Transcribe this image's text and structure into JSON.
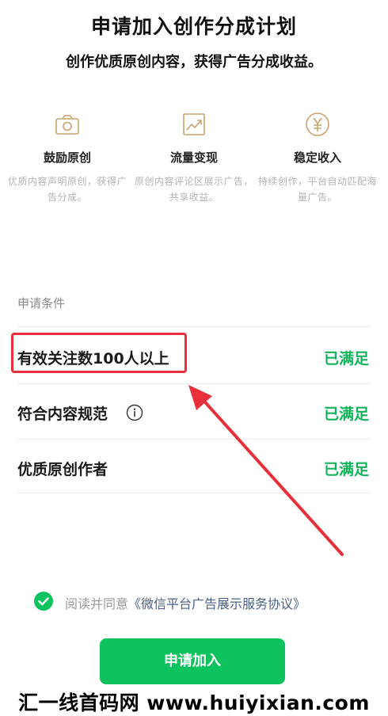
{
  "header": {
    "title": "申请加入创作分成计划",
    "subtitle": "创作优质原创内容，获得广告分成收益。"
  },
  "features": [
    {
      "icon": "camera-icon",
      "name": "鼓励原创",
      "desc": "优质内容声明原创，获得广告分成。"
    },
    {
      "icon": "trend-chart-icon",
      "name": "流量变现",
      "desc": "原创内容评论区展示广告，共享收益。"
    },
    {
      "icon": "yen-icon",
      "name": "稳定收入",
      "desc": "持续创作，平台自动匹配海量广告。"
    }
  ],
  "conditions": {
    "label": "申请条件",
    "items": [
      {
        "label": "有效关注数100人以上",
        "status": "已满足"
      },
      {
        "label": "符合内容规范",
        "status": "已满足"
      },
      {
        "label": "优质原创作者",
        "status": "已满足"
      }
    ]
  },
  "agreement": {
    "prefix": "阅读并同意",
    "link": "《微信平台广告展示服务协议》",
    "checked": true
  },
  "apply_button": "申请加入",
  "watermark": "汇一线首码网 www.huiyixian.com",
  "colors": {
    "accent": "#0ec35d",
    "status": "#11b35a",
    "icon_gold": "#c9a36b",
    "highlight": "#e8303a"
  }
}
